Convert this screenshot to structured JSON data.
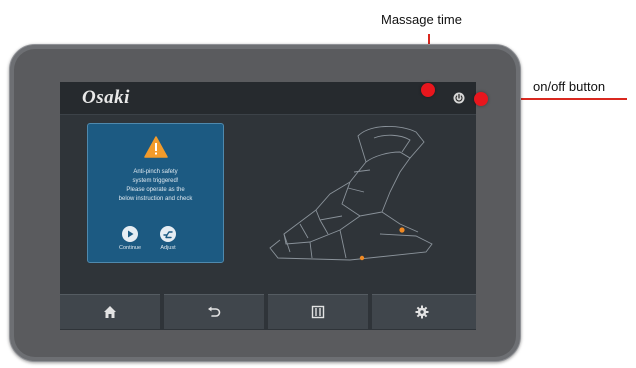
{
  "callouts": {
    "massage_time": "Massage time",
    "onoff_button": "on/off button"
  },
  "screen": {
    "brand": "Osaki",
    "dialog": {
      "icon": "warning-triangle-icon",
      "message_lines": [
        "Anti-pinch safety",
        "system triggered!",
        "Please operate as the",
        "below instruction and check"
      ],
      "buttons": [
        {
          "label": "Continue",
          "icon": "play-icon"
        },
        {
          "label": "Adjust",
          "icon": "recline-icon"
        }
      ]
    },
    "nav": [
      {
        "icon": "home-icon"
      },
      {
        "icon": "back-icon"
      },
      {
        "icon": "menu-icon"
      },
      {
        "icon": "gear-icon"
      }
    ]
  },
  "colors": {
    "callout_red": "#e8161d",
    "dialog_blue": "#1c5a82",
    "warning_orange": "#f29b2b",
    "screen_bg": "#2f3439",
    "bezel": "#5a5b5e"
  }
}
